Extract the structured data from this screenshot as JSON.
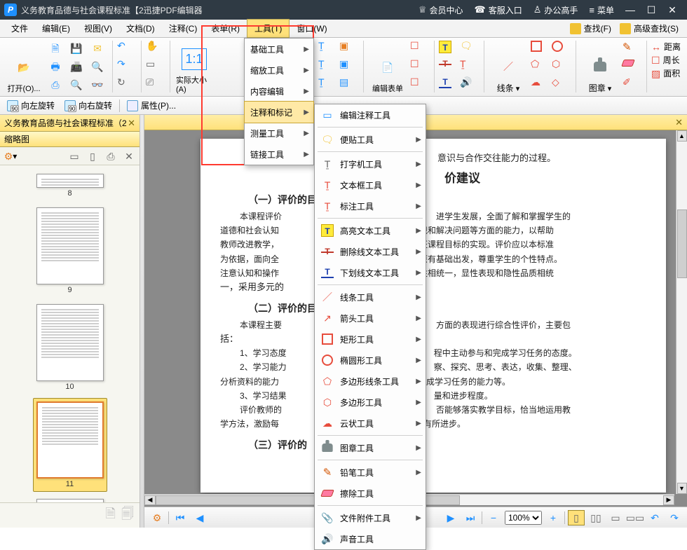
{
  "titlebar": {
    "logo": "P",
    "title": "义务教育品德与社会课程标准【2迅捷PDF编辑器",
    "links": {
      "member": "会员中心",
      "support": "客服入口",
      "expert": "办公高手",
      "menu": "菜单"
    }
  },
  "menubar": {
    "file": "文件",
    "edit": "编辑(E)",
    "view": "视图(V)",
    "document": "文档(D)",
    "comment": "注释(C)",
    "form": "表单(R)",
    "tools": "工具(T)",
    "window": "窗口(W)",
    "find": "查找(F)",
    "advfind": "高级查找(S)"
  },
  "ribbon": {
    "open": "打开(O)...",
    "actualsize": "实际大小(A)",
    "editform": "编辑表单",
    "lines": "线条",
    "stamp": "图章",
    "distance": "距离",
    "perimeter": "周长",
    "area": "面积"
  },
  "quickbar": {
    "rotate_left": "向左旋转",
    "rotate_right": "向右旋转",
    "properties": "属性(P)..."
  },
  "document_tab": "义务教育品德与社会课程标准（2",
  "sidebar": {
    "panel_title": "缩略图",
    "page_numbers": [
      "8",
      "9",
      "10",
      "11"
    ]
  },
  "tools_menu": {
    "basic": "基础工具",
    "zoom": "缩放工具",
    "content": "内容编辑",
    "annotate": "注释和标记",
    "measure": "测量工具",
    "link": "链接工具"
  },
  "annot_menu": {
    "edit_annot": "编辑注释工具",
    "sticky": "便贴工具",
    "typewriter": "打字机工具",
    "textbox": "文本框工具",
    "callout": "标注工具",
    "highlight": "高亮文本工具",
    "strike": "删除线文本工具",
    "underline": "下划线文本工具",
    "line": "线条工具",
    "arrow": "箭头工具",
    "rect": "矩形工具",
    "oval": "椭圆形工具",
    "polyline": "多边形线条工具",
    "polygon": "多边形工具",
    "cloud": "云状工具",
    "stamp": "图章工具",
    "pencil": "铅笔工具",
    "eraser": "擦除工具",
    "attachment": "文件附件工具",
    "sound": "声音工具"
  },
  "page_content": {
    "line_top": "意识与合作交往能力的过程。",
    "h2": "价建议",
    "h3a": "（一）评价的目",
    "p1a": "本课程评价",
    "p1b": "进学生发展，全面了解和掌握学生的",
    "p2a": "道德和社会认知",
    "p2b": "现和解决问题等方面的能力，以帮助",
    "p3a": "教师改进教学，",
    "p3b": "证课程目标的实现。评价应以本标准",
    "p4a": "为依据，面向全",
    "p4b": "原有基础出发，尊重学生的个性特点。",
    "p5a": "注意认知和操作",
    "p5b": "性相统一，显性表现和隐性品质相统",
    "p6": "一，采用多元的",
    "h3b": "（二）评价的目",
    "p7a": "本课程主要",
    "p7b": "方面的表现进行综合性评价，主要包",
    "p8": "括：",
    "p9a": "1、学习态度",
    "p9b": "程中主动参与和完成学习任务的态度。",
    "p10a": "2、学习能力",
    "p10b": "察、探究、思考、表达，收集、整理、",
    "p11a": "分析资料的能力",
    "p11b": "完成学习任务的能力等。",
    "p12a": "3、学习结果",
    "p12b": "量和进步程度。",
    "p13a": "评价教师的",
    "p13b": "否能够落实教学目标，恰当地运用教",
    "p14a": "学方法，激励每",
    "p14b": "有所进步。",
    "h3c": "（三）评价的"
  },
  "statusbar": {
    "zoom_value": "100%"
  }
}
